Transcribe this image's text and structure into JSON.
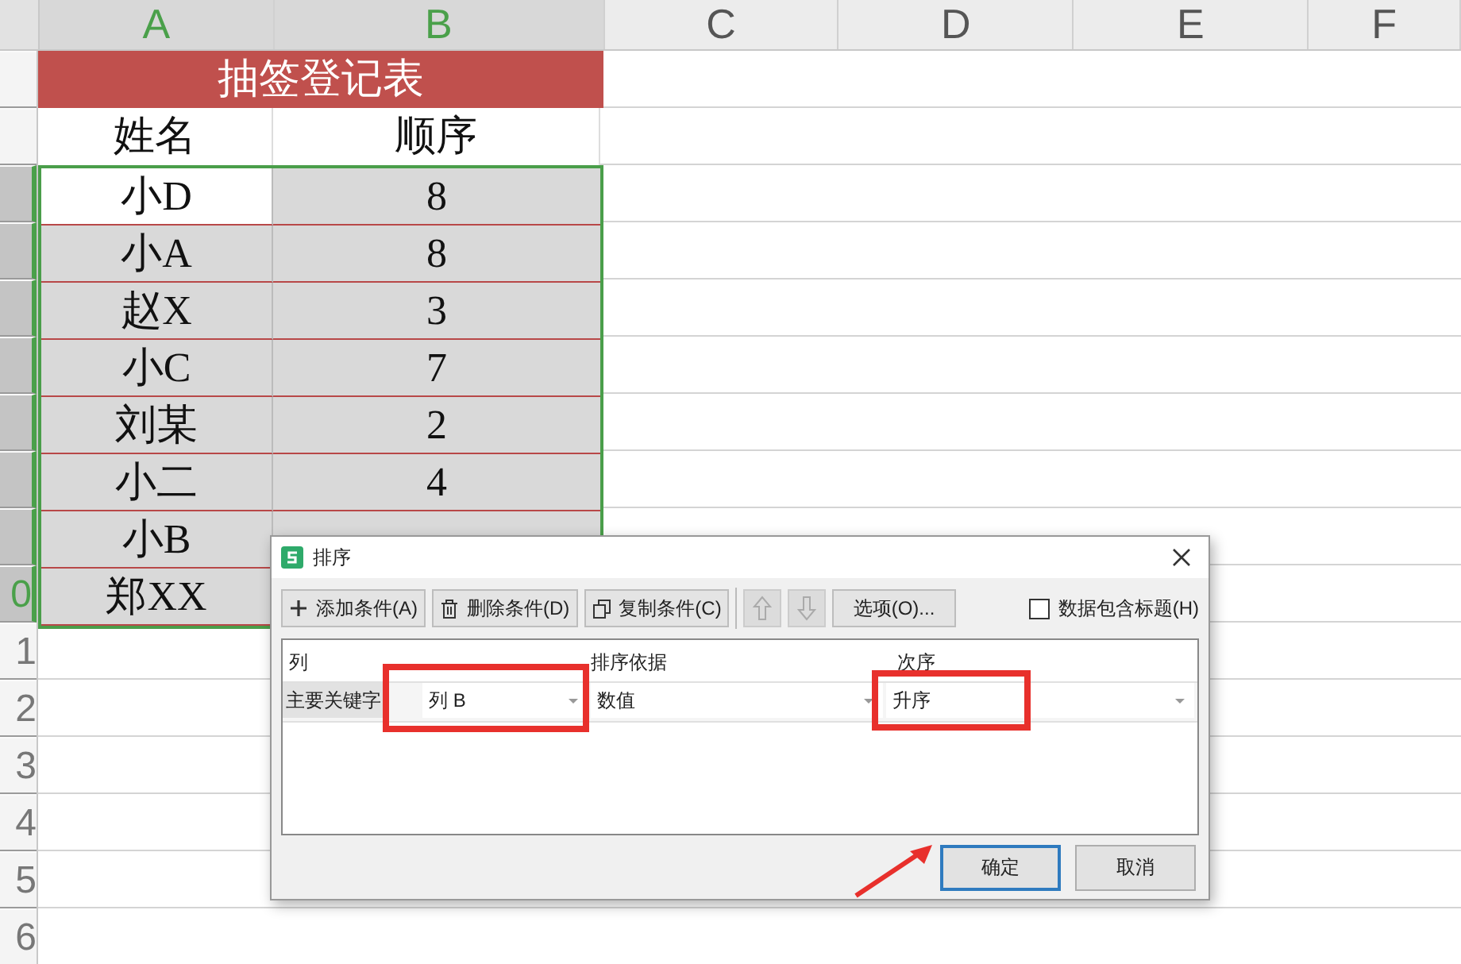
{
  "columns": [
    {
      "label": "A",
      "selected": true
    },
    {
      "label": "B",
      "selected": true
    },
    {
      "label": "C",
      "selected": false
    },
    {
      "label": "D",
      "selected": false
    },
    {
      "label": "E",
      "selected": false
    },
    {
      "label": "F",
      "selected": false
    }
  ],
  "row_headers": [
    {
      "selected": false
    },
    {
      "selected": false
    },
    {
      "selected": true
    },
    {
      "selected": true
    },
    {
      "selected": true
    },
    {
      "selected": true
    },
    {
      "selected": true
    },
    {
      "selected": true
    },
    {
      "selected": true
    },
    {
      "label": "0",
      "selected": true
    },
    {
      "label": "1",
      "selected": false
    },
    {
      "label": "2",
      "selected": false
    },
    {
      "label": "3",
      "selected": false
    },
    {
      "label": "4",
      "selected": false
    },
    {
      "label": "5",
      "selected": false
    },
    {
      "label": "6",
      "selected": false
    }
  ],
  "sheet": {
    "title": "抽签登记表",
    "headers": [
      "姓名",
      "顺序"
    ],
    "rows": [
      {
        "name": "小D",
        "value": "8",
        "active": true
      },
      {
        "name": "小A",
        "value": "8",
        "active": false
      },
      {
        "name": "赵X",
        "value": "3",
        "active": false
      },
      {
        "name": "小C",
        "value": "7",
        "active": false
      },
      {
        "name": "刘某",
        "value": "2",
        "active": false
      },
      {
        "name": "小二",
        "value": "4",
        "active": false
      },
      {
        "name": "小B",
        "active": false
      },
      {
        "name": "郑XX",
        "active": false
      }
    ]
  },
  "dialog": {
    "title": "排序",
    "toolbar": [
      {
        "kind": "icon-button",
        "label": "添加条件(A)"
      },
      {
        "kind": "icon-button",
        "label": "删除条件(D)"
      },
      {
        "kind": "icon-button",
        "label": "复制条件(C)"
      },
      {
        "kind": "arrow",
        "disabled": true
      },
      {
        "kind": "arrow",
        "disabled": true
      },
      {
        "kind": "button",
        "label": "选项(O)..."
      }
    ],
    "checkbox": {
      "label": "数据包含标题(H)",
      "checked": false
    },
    "grid_headers": [
      "列",
      "排序依据",
      "次序"
    ],
    "conditions": [
      {
        "label": "主要关键字",
        "column": "列 B",
        "basis": "数值",
        "order": "升序"
      }
    ],
    "buttons": [
      {
        "label": "确定",
        "default": true
      },
      {
        "label": "取消",
        "default": false
      }
    ]
  }
}
